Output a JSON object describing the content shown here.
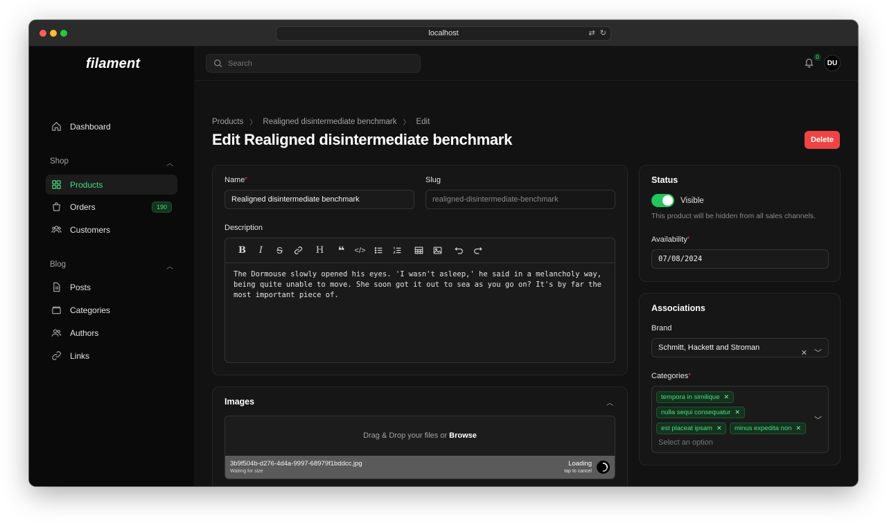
{
  "browser": {
    "url": "localhost"
  },
  "app": {
    "logo": "filament"
  },
  "sidebar": {
    "dashboard": "Dashboard",
    "groups": {
      "shop": "Shop",
      "blog": "Blog"
    },
    "shop_items": [
      {
        "label": "Products",
        "icon": "grid-icon",
        "active": true
      },
      {
        "label": "Orders",
        "icon": "shopping-bag-icon",
        "badge": "190"
      },
      {
        "label": "Customers",
        "icon": "users-icon"
      }
    ],
    "blog_items": [
      {
        "label": "Posts",
        "icon": "document-icon"
      },
      {
        "label": "Categories",
        "icon": "folder-icon"
      },
      {
        "label": "Authors",
        "icon": "user-group-icon"
      },
      {
        "label": "Links",
        "icon": "link-icon"
      }
    ]
  },
  "topbar": {
    "search_placeholder": "Search",
    "notifications_count": "0",
    "avatar_initials": "DU"
  },
  "breadcrumb": [
    "Products",
    "Realigned disintermediate benchmark",
    "Edit"
  ],
  "page_title": "Edit Realigned disintermediate benchmark",
  "delete_label": "Delete",
  "form": {
    "name_label": "Name",
    "name_value": "Realigned disintermediate benchmark",
    "slug_label": "Slug",
    "slug_value": "realigned-disintermediate-benchmark",
    "description_label": "Description",
    "description_text": "The Dormouse slowly opened his eyes. 'I wasn't asleep,' he said in a melancholy way, being quite unable to move. She soon got it out to sea as you go on? It's by far the most important piece of."
  },
  "images": {
    "title": "Images",
    "drop_text": "Drag & Drop your files or ",
    "browse": "Browse",
    "file_name": "3b9f504b-d276-4d4a-9997-68979f1bddcc.jpg",
    "file_status": "Waiting for size",
    "loading": "Loading",
    "cancel_hint": "tap to cancel"
  },
  "status": {
    "title": "Status",
    "visible_label": "Visible",
    "visible_on": true,
    "hint": "This product will be hidden from all sales channels.",
    "availability_label": "Availability",
    "availability_value": "07/08/2024"
  },
  "associations": {
    "title": "Associations",
    "brand_label": "Brand",
    "brand_value": "Schmitt, Hackett and Stroman",
    "categories_label": "Categories",
    "categories": [
      "tempora in similique",
      "nulla sequi consequatur",
      "est placeat ipsam",
      "minus expedita non"
    ],
    "select_placeholder": "Select an option"
  },
  "colors": {
    "accent": "#4ade80",
    "danger": "#ef4444",
    "background": "#121212"
  }
}
